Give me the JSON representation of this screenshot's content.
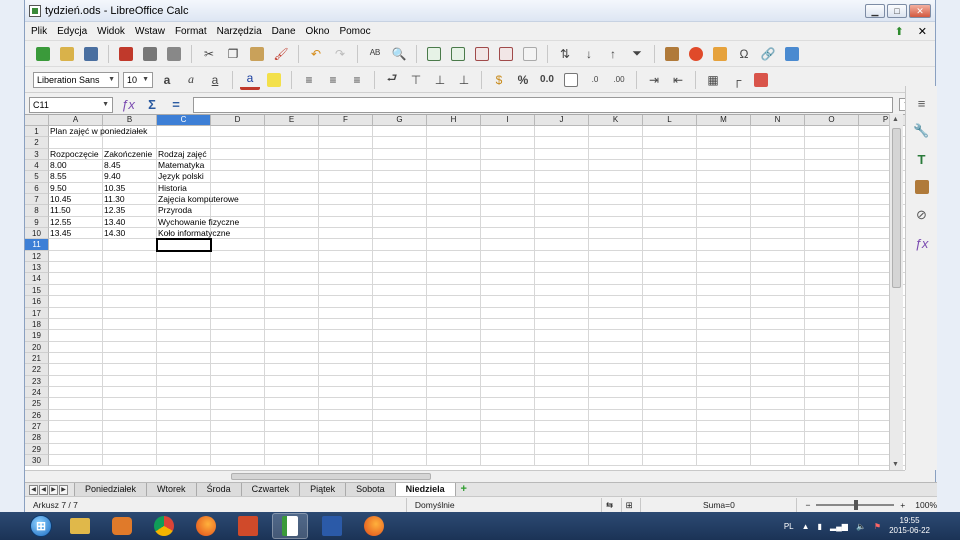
{
  "window": {
    "title": "tydzień.ods - LibreOffice Calc",
    "minimize": "▁",
    "maximize": "□",
    "close": "✕"
  },
  "menu": {
    "items": [
      "Plik",
      "Edycja",
      "Widok",
      "Wstaw",
      "Format",
      "Narzędzia",
      "Dane",
      "Okno",
      "Pomoc"
    ],
    "close_doc": "✕"
  },
  "formatting": {
    "font_name": "Liberation Sans",
    "font_size": "10"
  },
  "formula_bar": {
    "name_box": "C11",
    "function_wizard": "ƒx",
    "sum": "Σ",
    "equals": "="
  },
  "grid": {
    "columns": [
      "A",
      "B",
      "C",
      "D",
      "E",
      "F",
      "G",
      "H",
      "I",
      "J",
      "K",
      "L",
      "M",
      "N",
      "O",
      "P"
    ],
    "selected_column": "C",
    "selected_row": 11,
    "row_count": 30,
    "cells": {
      "1": {
        "A": "Plan zajęć w poniedziałek"
      },
      "3": {
        "A": "Rozpoczęcie",
        "B": "Zakończenie",
        "C": "Rodzaj zajęć"
      },
      "4": {
        "A": "8.00",
        "B": "8.45",
        "C": "Matematyka"
      },
      "5": {
        "A": "8.55",
        "B": "9.40",
        "C": "Język polski"
      },
      "6": {
        "A": "9.50",
        "B": "10.35",
        "C": "Historia"
      },
      "7": {
        "A": "10.45",
        "B": "11.30",
        "C": "Zajęcia komputerowe"
      },
      "8": {
        "A": "11.50",
        "B": "12.35",
        "C": "Przyroda"
      },
      "9": {
        "A": "12.55",
        "B": "13.40",
        "C": "Wychowanie fizyczne"
      },
      "10": {
        "A": "13.45",
        "B": "14.30",
        "C": "Koło informatyczne"
      }
    }
  },
  "sheet_tabs": {
    "tabs": [
      "Poniedziałek",
      "Wtorek",
      "Środa",
      "Czwartek",
      "Piątek",
      "Sobota",
      "Niedziela"
    ],
    "active": "Niedziela",
    "add": "+"
  },
  "status": {
    "sheet": "Arkusz 7 / 7",
    "page_style": "Domyślnie",
    "sum": "Suma=0",
    "zoom": "100%",
    "zoom_minus": "−",
    "zoom_plus": "+"
  },
  "taskbar": {
    "language": "PL",
    "time": "19:55",
    "date": "2015-06-22"
  }
}
